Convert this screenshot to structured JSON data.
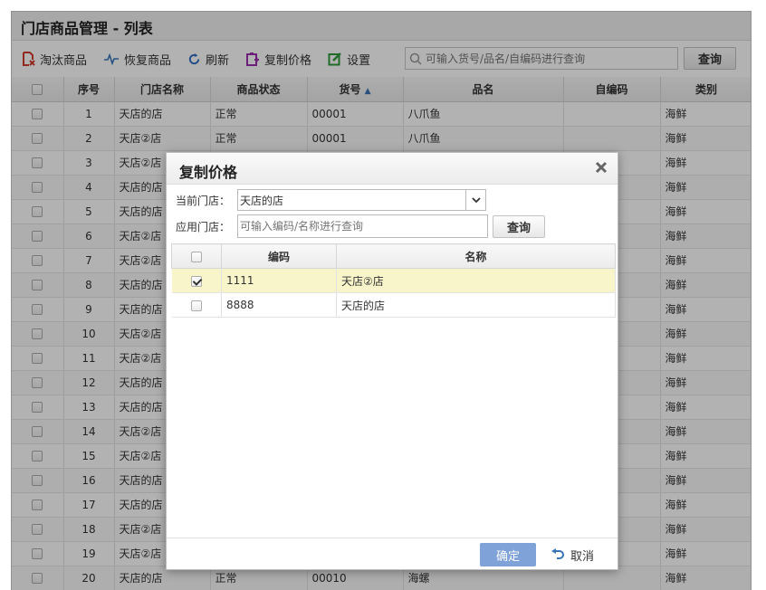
{
  "page": {
    "title": "门店商品管理 - 列表"
  },
  "toolbar": {
    "eliminate_label": "淘汰商品",
    "restore_label": "恢复商品",
    "refresh_label": "刷新",
    "copy_price_label": "复制价格",
    "settings_label": "设置",
    "search_placeholder": "可输入货号/品名/自编码进行查询",
    "search_button": "查询"
  },
  "grid": {
    "columns": [
      "序号",
      "门店名称",
      "商品状态",
      "货号",
      "品名",
      "自编码",
      "类别"
    ],
    "sort_indicator": "▲",
    "rows": [
      {
        "no": "1",
        "store": "天店的店",
        "status": "正常",
        "code": "00001",
        "name": "八爪鱼",
        "own_code": "",
        "category": "海鲜"
      },
      {
        "no": "2",
        "store": "天店②店",
        "status": "正常",
        "code": "00001",
        "name": "八爪鱼",
        "own_code": "",
        "category": "海鲜"
      },
      {
        "no": "3",
        "store": "天店②店",
        "category": "海鲜"
      },
      {
        "no": "4",
        "store": "天店的店",
        "category": "海鲜"
      },
      {
        "no": "5",
        "store": "天店的店",
        "category": "海鲜"
      },
      {
        "no": "6",
        "store": "天店②店",
        "category": "海鲜"
      },
      {
        "no": "7",
        "store": "天店②店",
        "category": "海鲜"
      },
      {
        "no": "8",
        "store": "天店的店",
        "category": "海鲜"
      },
      {
        "no": "9",
        "store": "天店的店",
        "category": "海鲜"
      },
      {
        "no": "10",
        "store": "天店②店",
        "category": "海鲜"
      },
      {
        "no": "11",
        "store": "天店②店",
        "category": "海鲜"
      },
      {
        "no": "12",
        "store": "天店的店",
        "category": "海鲜"
      },
      {
        "no": "13",
        "store": "天店的店",
        "category": "海鲜"
      },
      {
        "no": "14",
        "store": "天店②店",
        "category": "海鲜"
      },
      {
        "no": "15",
        "store": "天店②店",
        "category": "海鲜"
      },
      {
        "no": "16",
        "store": "天店的店",
        "category": "海鲜"
      },
      {
        "no": "17",
        "store": "天店的店",
        "category": "海鲜"
      },
      {
        "no": "18",
        "store": "天店②店",
        "category": "海鲜"
      },
      {
        "no": "19",
        "store": "天店②店",
        "category": "海鲜"
      },
      {
        "no": "20",
        "store": "天店的店",
        "status": "正常",
        "code": "00010",
        "name": "海螺",
        "own_code": "",
        "category": "海鲜"
      }
    ]
  },
  "dialog": {
    "title": "复制价格",
    "current_store_label": "当前门店：",
    "current_store_value": "天店的店",
    "apply_store_label": "应用门店：",
    "apply_store_placeholder": "可输入编码/名称进行查询",
    "query_button": "查询",
    "columns": [
      "编码",
      "名称"
    ],
    "rows": [
      {
        "code": "1111",
        "name": "天店②店",
        "checked": true
      },
      {
        "code": "8888",
        "name": "天店的店",
        "checked": false
      }
    ],
    "ok_label": "确定",
    "cancel_label": "取消"
  },
  "colors": {
    "ok_button": "#7fa2d8",
    "selected_row": "#f7f5c9",
    "eliminate_icon": "#d23b2d",
    "copy_icon": "#9b2fae",
    "settings_icon": "#2e9a3a",
    "refresh_icon": "#2f6fc0"
  }
}
